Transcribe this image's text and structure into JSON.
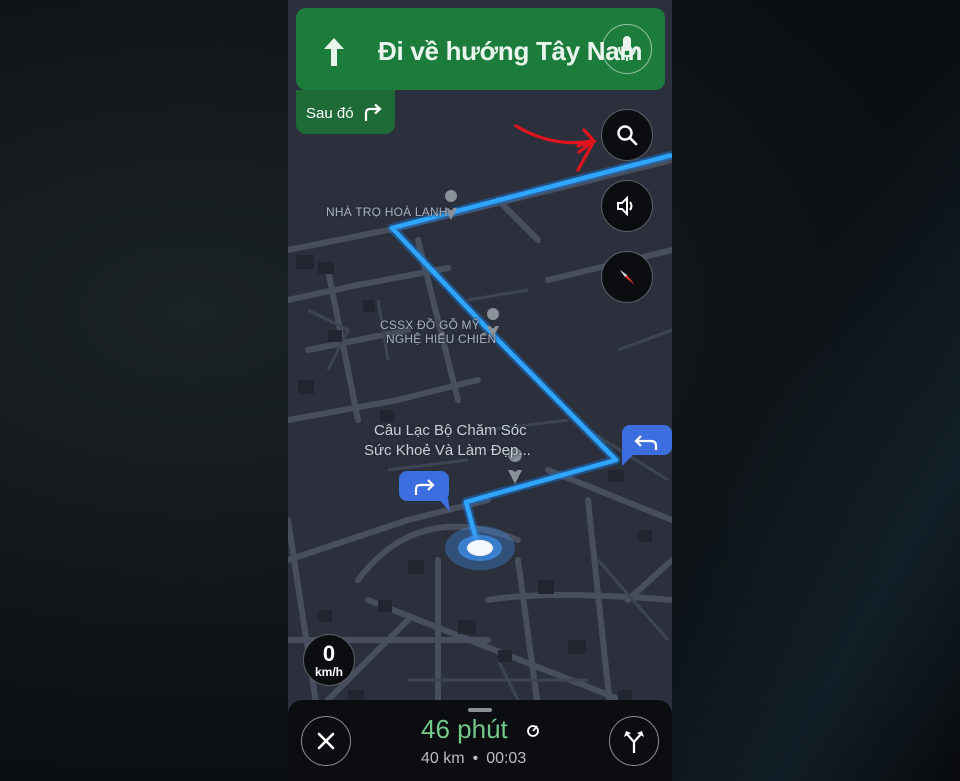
{
  "navigation": {
    "direction": "Đi về hướng Tây Nam",
    "then_label": "Sau đó"
  },
  "map": {
    "places": [
      "NHÀ TRỌ HOÀ LANH",
      "CSSX ĐỒ GỖ MỸ",
      "NGHỆ HIẾU CHIẾN",
      "Câu Lạc Bộ Chăm Sóc",
      "Sức Khoẻ Và Làm Đẹp..."
    ]
  },
  "speed": {
    "value": "0",
    "unit": "km/h"
  },
  "trip": {
    "eta_time": "46 phút",
    "distance": "40 km",
    "separator": "•",
    "arrival_clock": "00:03"
  },
  "icons": {
    "direction_arrow": "arrow-up-icon",
    "then_arrow": "turn-right-icon",
    "mic": "mic-icon",
    "search": "search-icon",
    "sound": "speaker-icon",
    "compass": "compass-icon",
    "close": "close-icon",
    "routes": "alternate-routes-icon"
  },
  "colors": {
    "banner_green": "#1c7c3c",
    "route_blue": "#2ea6ff",
    "eta_green": "#71c98a",
    "annotation_red": "#e0141e"
  }
}
